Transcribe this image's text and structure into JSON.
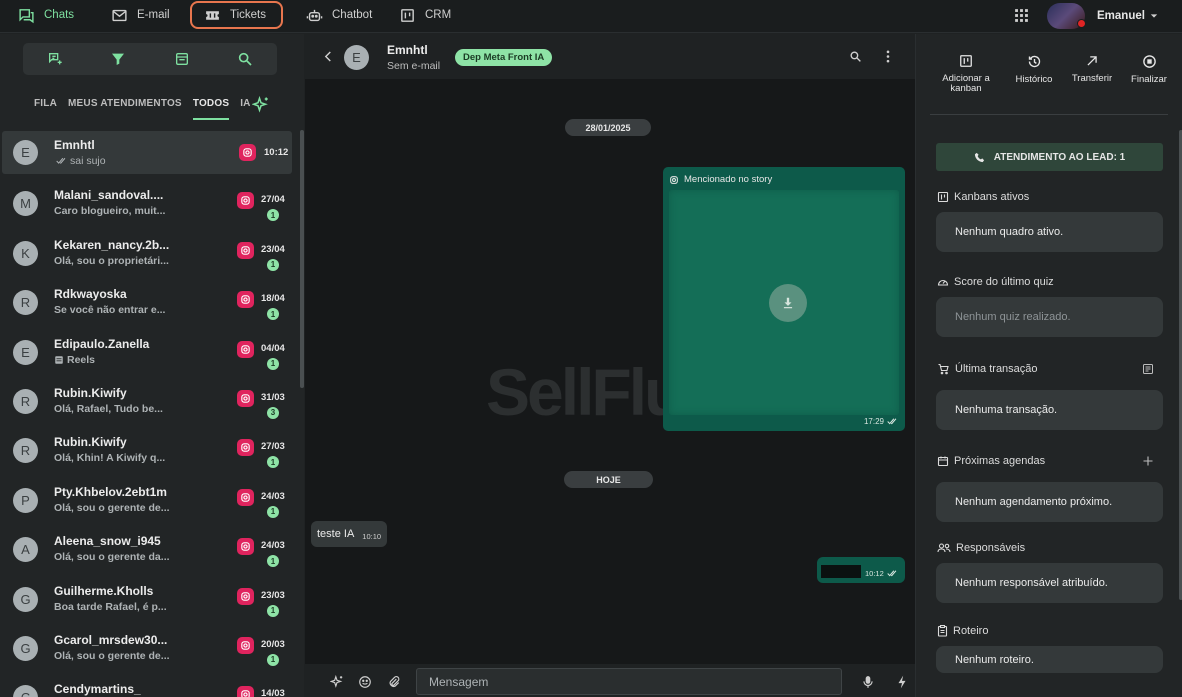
{
  "nav": {
    "items": [
      {
        "label": "Chats",
        "icon": "chat-icon"
      },
      {
        "label": "E-mail",
        "icon": "mail-icon"
      },
      {
        "label": "Tickets",
        "icon": "ticket-icon"
      },
      {
        "label": "Chatbot",
        "icon": "robot-icon"
      },
      {
        "label": "CRM",
        "icon": "kanban-icon"
      }
    ],
    "user_name": "Emanuel"
  },
  "left": {
    "tabs": [
      "FILA",
      "MEUS ATENDIMENTOS",
      "TODOS",
      "IA"
    ],
    "active_tab": "TODOS",
    "conversations": [
      {
        "initial": "E",
        "name": "Emnhtl",
        "preview": "sai sujo",
        "time": "10:12",
        "badge": ""
      },
      {
        "initial": "M",
        "name": "Malani_sandoval....",
        "preview": "Caro blogueiro, muit...",
        "time": "27/04",
        "badge": "1"
      },
      {
        "initial": "K",
        "name": "Kekaren_nancy.2b...",
        "preview": "Olá, sou o proprietári...",
        "time": "23/04",
        "badge": "1"
      },
      {
        "initial": "R",
        "name": "Rdkwayoska",
        "preview": "Se você não entrar e...",
        "time": "18/04",
        "badge": "1"
      },
      {
        "initial": "E",
        "name": "Edipaulo.Zanella",
        "preview": "Reels",
        "time": "04/04",
        "badge": "1"
      },
      {
        "initial": "R",
        "name": "Rubin.Kiwify",
        "preview": "Olá, Rafael, Tudo be...",
        "time": "31/03",
        "badge": "3"
      },
      {
        "initial": "R",
        "name": "Rubin.Kiwify",
        "preview": "Olá, Khin! A Kiwify q...",
        "time": "27/03",
        "badge": "1"
      },
      {
        "initial": "P",
        "name": "Pty.Khbelov.2ebt1m",
        "preview": "Olá, sou o gerente de...",
        "time": "24/03",
        "badge": "1"
      },
      {
        "initial": "A",
        "name": "Aleena_snow_i945",
        "preview": "Olá, sou o gerente da...",
        "time": "24/03",
        "badge": "1"
      },
      {
        "initial": "G",
        "name": "Guilherme.Kholls",
        "preview": "Boa tarde Rafael, é p...",
        "time": "23/03",
        "badge": "1"
      },
      {
        "initial": "G",
        "name": "Gcarol_mrsdew30...",
        "preview": "Olá, sou o gerente de...",
        "time": "20/03",
        "badge": "1"
      },
      {
        "initial": "C",
        "name": "Cendymartins_",
        "preview": "",
        "time": "14/03",
        "badge": ""
      }
    ]
  },
  "chat": {
    "initial": "E",
    "name": "Emnhtl",
    "email": "Sem e-mail",
    "tag": "Dep Meta Front IA",
    "watermark": "SellFlu",
    "date1": "28/01/2025",
    "story_label": "Mencionado no story",
    "story_time": "17:29",
    "date2": "HOJE",
    "msg_in_text": "teste IA",
    "msg_in_time": "10:10",
    "msg_out_time": "10:12",
    "input_placeholder": "Mensagem"
  },
  "right": {
    "actions": [
      {
        "label": "Adicionar a kanban",
        "icon": "kanban-icon"
      },
      {
        "label": "Histórico",
        "icon": "history-icon"
      },
      {
        "label": "Transferir",
        "icon": "arrow-up-right-icon"
      },
      {
        "label": "Finalizar",
        "icon": "stop-icon"
      }
    ],
    "lead_button": "ATENDIMENTO AO LEAD: 1",
    "sections": [
      {
        "title": "Kanbans ativos",
        "value": "Nenhum quadro ativo."
      },
      {
        "title": "Score do último quiz",
        "value": "Nenhum quiz realizado."
      },
      {
        "title": "Última transação",
        "value": "Nenhuma transação."
      },
      {
        "title": "Próximas agendas",
        "value": "Nenhum agendamento próximo."
      },
      {
        "title": "Responsáveis",
        "value": "Nenhum responsável atribuído."
      },
      {
        "title": "Roteiro",
        "value": "Nenhum roteiro."
      }
    ]
  },
  "colors": {
    "accent_green": "#7ee0a0",
    "tickets_outline": "#e8764e",
    "instagram": "#e0245e",
    "outgoing_bubble": "#0d5a4a"
  }
}
